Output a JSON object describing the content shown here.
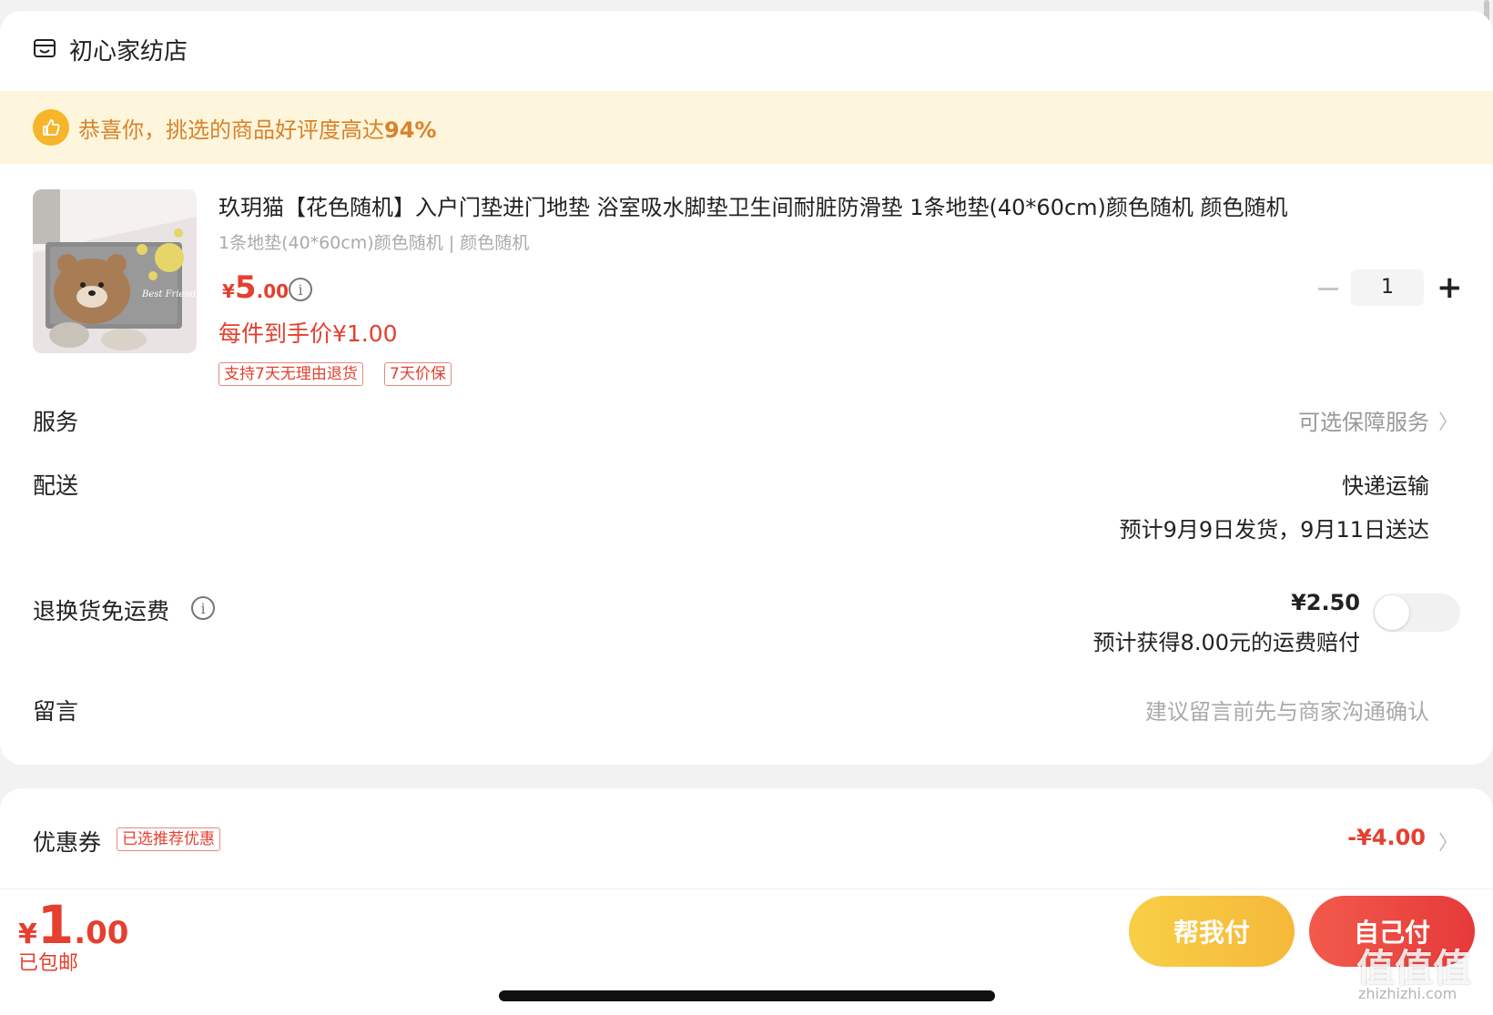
{
  "shop": {
    "name": "初心家纺店",
    "icon": "store-icon"
  },
  "banner": {
    "text": "恭喜你，挑选的商品好评度高达",
    "highlight": "94%",
    "icon": "thumbs-up-icon",
    "color": "#d9822b"
  },
  "product": {
    "title": "玖玥猫【花色随机】入户门垫进门地垫 浴室吸水脚垫卫生间耐脏防滑垫 1条地垫(40*60cm)颜色随机 颜色随机",
    "spec": "1条地垫(40*60cm)颜色随机 | 颜色随机",
    "price_symbol": "¥",
    "price_int": "5",
    "price_dec": ".00",
    "per_price": "每件到手价¥1.00",
    "tags": [
      "支持7天无理由退货",
      "7天价保"
    ],
    "quantity": "1",
    "image_text": "Best Friend"
  },
  "rows": {
    "service": {
      "label": "服务",
      "value": "可选保障服务"
    },
    "delivery": {
      "label": "配送",
      "method": "快递运输",
      "estimate": "预计9月9日发货，9月11日送达"
    },
    "return": {
      "label": "退换货免运费",
      "price": "¥2.50",
      "note": "预计获得8.00元的运费赔付",
      "enabled": false
    },
    "message": {
      "label": "留言",
      "placeholder": "建议留言前先与商家沟通确认"
    }
  },
  "coupon": {
    "label": "优惠券",
    "badge": "已选推荐优惠",
    "value": "-¥4.00"
  },
  "footer": {
    "total_symbol": "¥",
    "total_int": "1",
    "total_dec": ".00",
    "shipping": "已包邮",
    "help_pay": "帮我付",
    "self_pay": "自己付"
  },
  "watermark": {
    "main": "值值值",
    "sub": "zhizhizhi.com"
  },
  "colors": {
    "accent": "#e53f2f",
    "banner_bg": "#fdf6dc",
    "help_btn": "#f6c13f",
    "self_btn": "#e8443a"
  }
}
